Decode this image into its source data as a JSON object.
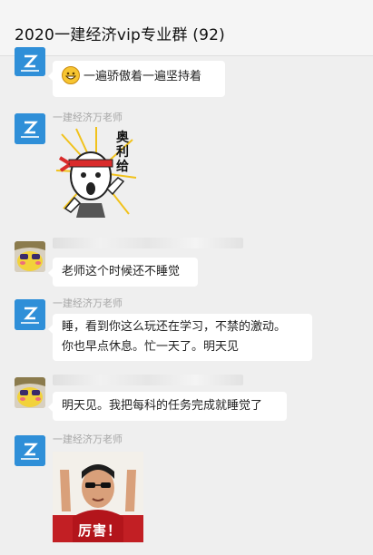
{
  "chat": {
    "title": "2020一建经济vip专业群 (92)"
  },
  "messages": {
    "m1": {
      "text": "一遍骄傲着一遍坚持着",
      "emoji_icon": "grinning-face-icon"
    },
    "m2": {
      "sender": "一建经济万老师",
      "sticker_text": "奥利给"
    },
    "m3": {
      "text": "老师这个时候还不睡觉"
    },
    "m4": {
      "sender": "一建经济万老师",
      "line1": "睡，看到你这么玩还在学习，不禁的激动。",
      "line2": "你也早点休息。忙一天了。明天见"
    },
    "m5": {
      "text": "明天见。我把每科的任务完成就睡觉了"
    },
    "m6": {
      "sender": "一建经济万老师",
      "sticker_text": "厉害！"
    }
  },
  "colors": {
    "background": "#efefef",
    "header": "#f5f5f5",
    "bubble": "#ffffff",
    "teacher_avatar": "#2f8fd8"
  }
}
